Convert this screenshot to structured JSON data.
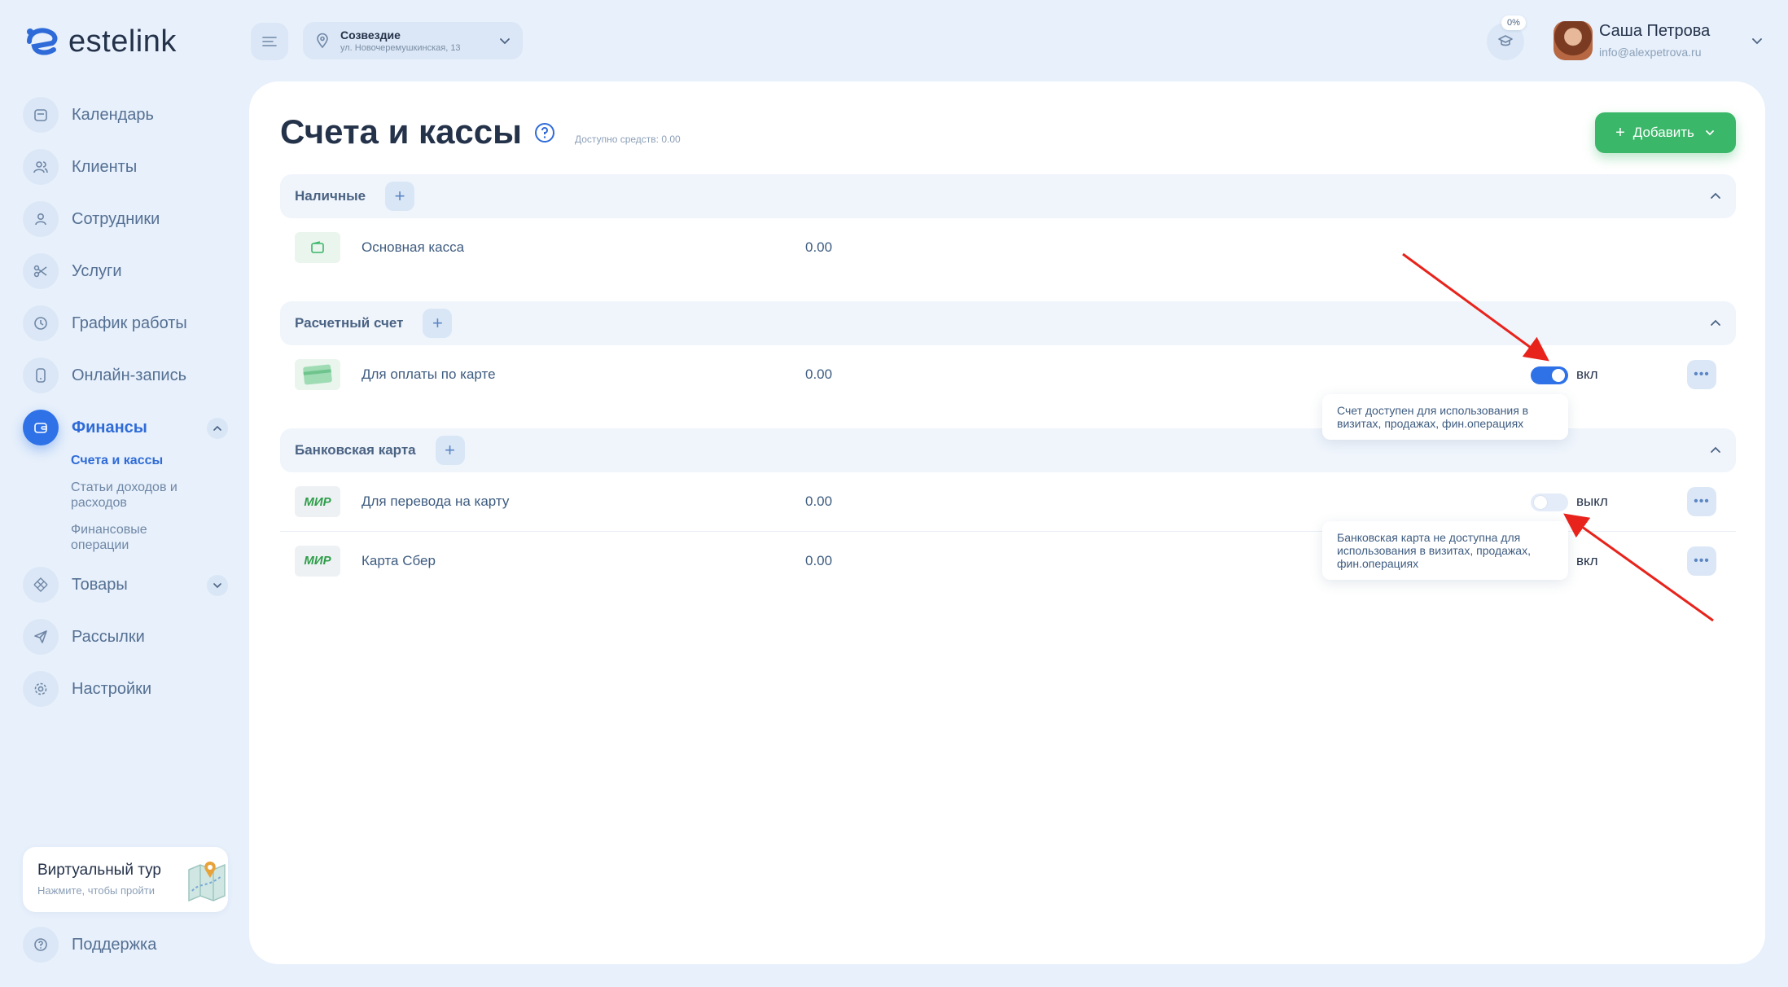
{
  "app": {
    "name": "estelink"
  },
  "branch": {
    "name": "Созвездие",
    "address": "ул. Новочеремушкинская, 13"
  },
  "user": {
    "name": "Саша Петрова",
    "email": "info@alexpetrova.ru",
    "progress_badge": "0%"
  },
  "sidebar": {
    "items": [
      {
        "label": "Календарь",
        "icon": "calendar-icon"
      },
      {
        "label": "Клиенты",
        "icon": "clients-icon"
      },
      {
        "label": "Сотрудники",
        "icon": "person-icon"
      },
      {
        "label": "Услуги",
        "icon": "scissors-icon"
      },
      {
        "label": "График работы",
        "icon": "clock-icon"
      },
      {
        "label": "Онлайн-запись",
        "icon": "phone-icon"
      },
      {
        "label": "Финансы",
        "icon": "wallet-icon"
      },
      {
        "label": "Товары",
        "icon": "box-icon"
      },
      {
        "label": "Рассылки",
        "icon": "send-icon"
      },
      {
        "label": "Настройки",
        "icon": "gear-icon"
      }
    ],
    "finance_sub": [
      "Счета и кассы",
      "Статьи доходов и расходов",
      "Финансовые операции"
    ],
    "tour": {
      "title": "Виртуальный тур",
      "subtitle": "Нажмите, чтобы пройти"
    },
    "support": "Поддержка"
  },
  "main": {
    "title": "Счета и кассы",
    "available": "Доступно средств: 0.00",
    "add_button": "Добавить",
    "sections": [
      {
        "name": "Наличные",
        "rows": [
          {
            "name": "Основная касса",
            "amount": "0.00"
          }
        ]
      },
      {
        "name": "Расчетный счет",
        "rows": [
          {
            "name": "Для оплаты по карте",
            "amount": "0.00",
            "state": "вкл"
          }
        ]
      },
      {
        "name": "Банковская карта",
        "rows": [
          {
            "name": "Для перевода на карту",
            "amount": "0.00",
            "state": "выкл",
            "logo": "МИР"
          },
          {
            "name": "Карта Сбер",
            "amount": "0.00",
            "state": "вкл",
            "logo": "МИР"
          }
        ]
      }
    ],
    "tooltips": {
      "on": "Счет доступен для использования в визитах, продажах, фин.операциях",
      "off": "Банковская карта не доступна для использования в визитах, продажах, фин.операциях"
    }
  },
  "colors": {
    "accent": "#2f72e8",
    "success": "#3ab768",
    "annotation": "#e8231c"
  }
}
